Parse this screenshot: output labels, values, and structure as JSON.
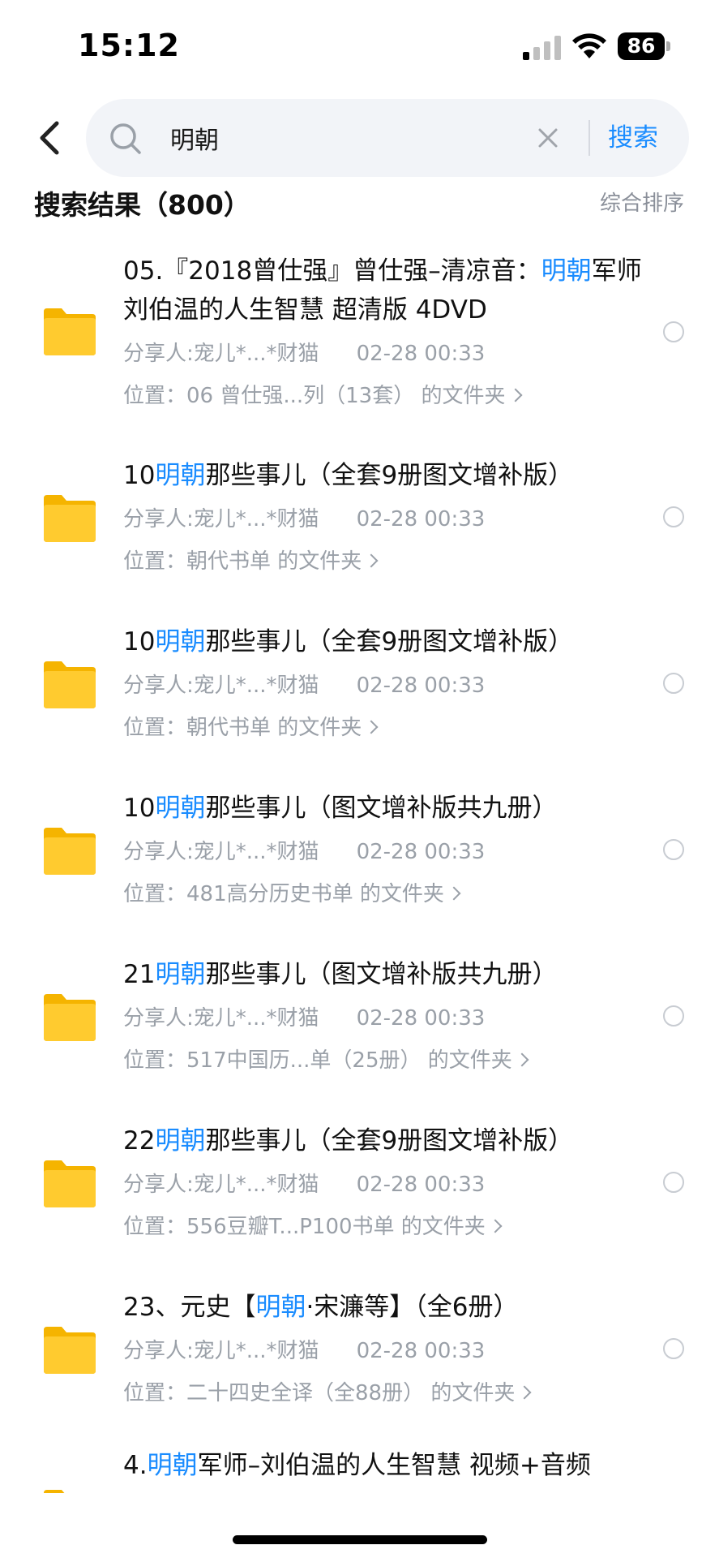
{
  "status_bar": {
    "time": "15:12",
    "battery": "86"
  },
  "search": {
    "query": "明朝",
    "button_label": "搜索"
  },
  "results": {
    "title": "搜索结果（800）",
    "sort_label": "综合排序",
    "items": [
      {
        "title_parts": [
          "05.『2018曾仕强』曾仕强–清凉音：",
          "明朝",
          "军师刘伯温的人生智慧 超清版 4DVD"
        ],
        "sharer": "分享人:宠儿*...*财猫",
        "date": "02-28 00:33",
        "location": "位置：06 曾仕强...列（13套） 的文件夹"
      },
      {
        "title_parts": [
          "10",
          "明朝",
          "那些事儿（全套9册图文增补版）"
        ],
        "sharer": "分享人:宠儿*...*财猫",
        "date": "02-28 00:33",
        "location": "位置：朝代书单 的文件夹"
      },
      {
        "title_parts": [
          "10",
          "明朝",
          "那些事儿（全套9册图文增补版）"
        ],
        "sharer": "分享人:宠儿*...*财猫",
        "date": "02-28 00:33",
        "location": "位置：朝代书单 的文件夹"
      },
      {
        "title_parts": [
          "10",
          "明朝",
          "那些事儿（图文增补版共九册）"
        ],
        "sharer": "分享人:宠儿*...*财猫",
        "date": "02-28 00:33",
        "location": "位置：481高分历史书单 的文件夹"
      },
      {
        "title_parts": [
          "21",
          "明朝",
          "那些事儿（图文增补版共九册）"
        ],
        "sharer": "分享人:宠儿*...*财猫",
        "date": "02-28 00:33",
        "location": "位置：517中国历...单（25册） 的文件夹"
      },
      {
        "title_parts": [
          "22",
          "明朝",
          "那些事儿（全套9册图文增补版）"
        ],
        "sharer": "分享人:宠儿*...*财猫",
        "date": "02-28 00:33",
        "location": "位置：556豆瓣T...P100书单 的文件夹"
      },
      {
        "title_parts": [
          "23、元史【",
          "明朝",
          "·宋濂等】（全6册）"
        ],
        "sharer": "分享人:宠儿*...*财猫",
        "date": "02-28 00:33",
        "location": "位置：二十四史全译（全88册） 的文件夹"
      },
      {
        "title_parts": [
          "4.",
          "明朝",
          "军师–刘伯温的人生智慧 视频+音频"
        ]
      }
    ]
  },
  "colors": {
    "accent": "#1a8cff",
    "meta_text": "#9aa0a8",
    "folder": "#ffcb2f"
  }
}
